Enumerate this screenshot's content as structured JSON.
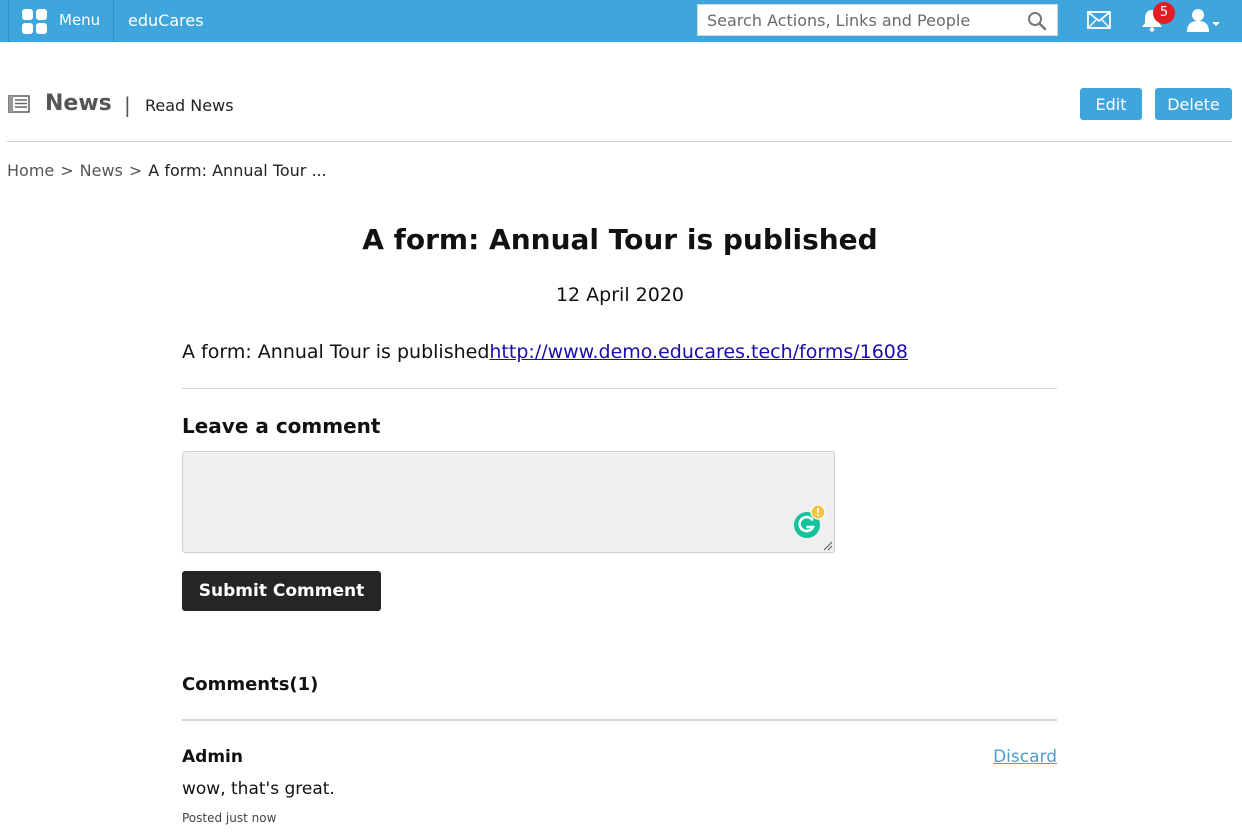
{
  "topbar": {
    "menu_label": "Menu",
    "menu_icon": "grid-icon",
    "brand": "eduCares",
    "search_placeholder": "Search Actions, Links and People",
    "search_icon": "search-icon",
    "mail_icon": "mail-icon",
    "notifications_icon": "bell-icon",
    "notification_count": "5",
    "user_icon": "user-icon",
    "bar_color": "#3ea6dd",
    "badge_color": "#e41c23"
  },
  "header": {
    "icon": "newspaper-icon",
    "title": "News",
    "separator": "|",
    "subtitle": "Read News",
    "edit_label": "Edit",
    "delete_label": "Delete"
  },
  "breadcrumb": {
    "items": [
      "Home",
      "News"
    ],
    "separator": ">",
    "current": "A form: Annual Tour ..."
  },
  "article": {
    "title": "A form: Annual Tour is published",
    "date": "12 April 2020",
    "body_text": "A form: Annual Tour is published",
    "body_link": "http://www.demo.educares.tech/forms/1608"
  },
  "comment_form": {
    "heading": "Leave a comment",
    "value": "",
    "submit_label": "Submit Comment"
  },
  "comments": {
    "heading": "Comments(1)",
    "items": [
      {
        "author": "Admin",
        "text": "wow, that's great.",
        "time": "Posted just now",
        "discard_label": "Discard"
      }
    ]
  }
}
